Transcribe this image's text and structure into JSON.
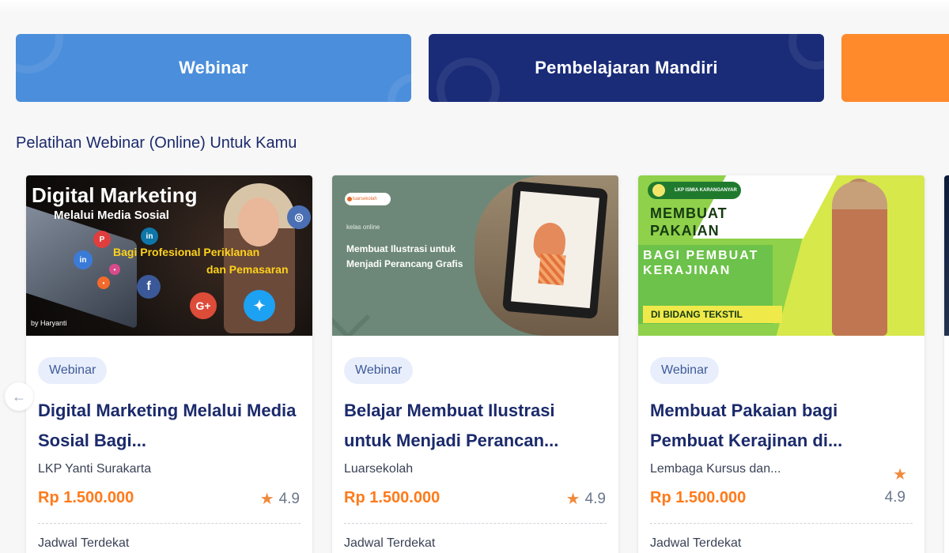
{
  "categories": [
    {
      "label": "Webinar",
      "color": "#4b8edb"
    },
    {
      "label": "Pembelajaran Mandiri",
      "color": "#1a2b78"
    },
    {
      "label": "",
      "color": "#ff8a2b"
    }
  ],
  "section_title": "Pelatihan Webinar (Online) Untuk Kamu",
  "carousel": {
    "prev_icon": "arrow-left-icon",
    "prev_glyph": "←"
  },
  "cards": [
    {
      "badge": "Webinar",
      "title": "Digital Marketing Melalui Media Sosial Bagi...",
      "provider": "LKP Yanti Surakarta",
      "price": "Rp 1.500.000",
      "rating": "4.9",
      "schedule_label": "Jadwal Terdekat",
      "thumb": {
        "line1": "Digital Marketing",
        "line2": "Melalui Media Sosial",
        "line3": "Bagi Profesional Periklanan",
        "line4": "dan Pemasaran",
        "credit": "by Haryanti"
      }
    },
    {
      "badge": "Webinar",
      "title": "Belajar Membuat Ilustrasi untuk Menjadi Perancan...",
      "provider": "Luarsekolah",
      "price": "Rp 1.500.000",
      "rating": "4.9",
      "schedule_label": "Jadwal Terdekat",
      "thumb": {
        "logo": "luarsekolah",
        "small": "kelas online",
        "title": "Membuat Ilustrasi untuk Menjadi Perancang Grafis"
      }
    },
    {
      "badge": "Webinar",
      "title": "Membuat Pakaian bagi Pembuat Kerajinan di...",
      "provider": "Lembaga Kursus dan...",
      "price": "Rp 1.500.000",
      "rating": "4.9",
      "schedule_label": "Jadwal Terdekat",
      "thumb": {
        "org": "LKP ISMIA KARANGANYAR",
        "head1": "MEMBUAT PAKAIAN",
        "head2": "BAGI PEMBUAT KERAJINAN",
        "strip": "DI BIDANG TEKSTIL"
      }
    }
  ],
  "colors": {
    "accent_blue": "#1b2a6b",
    "price_orange": "#ff7a1a",
    "star": "#f08a3c"
  }
}
